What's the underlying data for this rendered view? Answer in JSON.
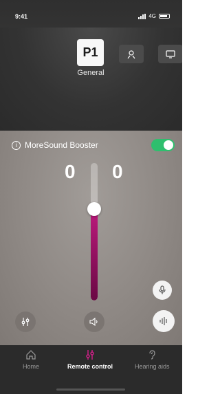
{
  "status": {
    "time": "9:41",
    "network": "4G"
  },
  "program": {
    "label": "P1",
    "name": "General"
  },
  "feature": {
    "title": "MoreSound Booster",
    "enabled": true,
    "toggle_color": "#2fbf6e"
  },
  "volume": {
    "left": "0",
    "right": "0",
    "level_fraction": 0.63,
    "accent": "#b8197a"
  },
  "controls": {
    "equalizer_icon": "sliders-icon",
    "sound_icon": "speaker-icon",
    "mic_icon": "microphone-icon",
    "waveform_icon": "waveform-icon"
  },
  "tabs": [
    {
      "label": "Home",
      "icon": "home-icon",
      "active": false
    },
    {
      "label": "Remote control",
      "icon": "sliders-icon",
      "active": true
    },
    {
      "label": "Hearing aids",
      "icon": "ear-icon",
      "active": false
    }
  ]
}
